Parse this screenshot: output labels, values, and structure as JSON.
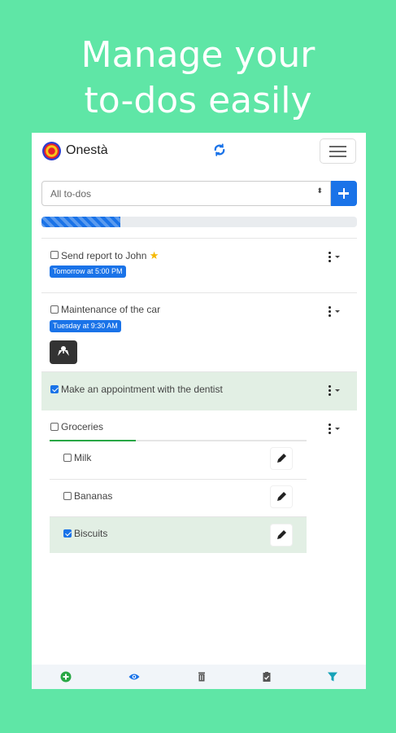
{
  "headline": {
    "line1": "Manage your",
    "line2": "to-dos easily"
  },
  "app": {
    "name": "Onestà"
  },
  "filter": {
    "value": "All to-dos",
    "caret": "⬍"
  },
  "progress": {
    "fraction": 0.25
  },
  "todos": [
    {
      "title": "Send report to John",
      "starred": true,
      "checked": false,
      "badge": "Tomorrow at 5:00 PM"
    },
    {
      "title": "Maintenance of the car",
      "checked": false,
      "badge": "Tuesday at 9:30 AM",
      "has_map": true
    },
    {
      "title": "Make an appointment with the dentist",
      "checked": true
    },
    {
      "title": "Groceries",
      "checked": false,
      "subtasks": [
        {
          "title": "Milk",
          "checked": false
        },
        {
          "title": "Bananas",
          "checked": false
        },
        {
          "title": "Biscuits",
          "checked": true
        }
      ]
    }
  ],
  "icons": {
    "sync": "sync-icon",
    "menu": "hamburger-icon",
    "add": "plus-icon",
    "more": "kebab-icon",
    "map": "map-icon",
    "edit": "pencil-icon",
    "bottom": [
      "add-circle-icon",
      "eye-icon",
      "trash-icon",
      "clipboard-check-icon",
      "filter-icon"
    ]
  },
  "colors": {
    "background": "#5fe6a6",
    "primary": "#1a73e8",
    "success": "#28a745",
    "completed_row": "#e2efe4"
  }
}
